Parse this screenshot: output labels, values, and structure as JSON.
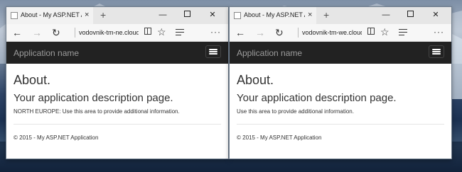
{
  "windows": [
    {
      "tab": {
        "title": "About - My ASP.NET Ap"
      },
      "address": "vodovnik-tm-ne.cloud",
      "site": {
        "app_name": "Application name",
        "heading": "About.",
        "subheading": "Your application description page.",
        "paragraph": "NORTH EUROPE: Use this area to provide additional information.",
        "footer": "© 2015 - My ASP.NET Application"
      }
    },
    {
      "tab": {
        "title": "About - My ASP.NET Ap"
      },
      "address": "vodovnik-tm-we.cloud",
      "site": {
        "app_name": "Application name",
        "heading": "About.",
        "subheading": "Your application description page.",
        "paragraph": "Use this area to provide additional information.",
        "footer": "© 2015 - My ASP.NET Application"
      }
    }
  ],
  "icons": {
    "tab_close": "×",
    "new_tab": "+",
    "minimize": "—",
    "close": "✕",
    "back": "←",
    "forward": "→",
    "refresh": "↻",
    "favorite": "☆",
    "more": "···"
  },
  "colors": {
    "site_navbar": "#222222",
    "app_name_text": "#9d9d9d",
    "tabstrip": "#e6e6e6"
  }
}
